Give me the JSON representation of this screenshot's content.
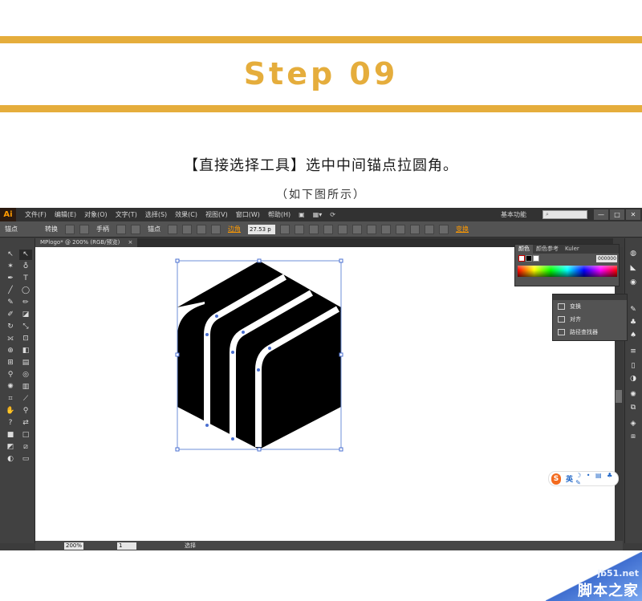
{
  "header": {
    "step": "Step 09",
    "instruction": "【直接选择工具】选中中间锚点拉圆角。",
    "subtitle": "（如下图所示）",
    "accent_color": "#e5ad3c"
  },
  "app": {
    "logo": "Ai",
    "menu": [
      "文件(F)",
      "编辑(E)",
      "对象(O)",
      "文字(T)",
      "选择(S)",
      "效果(C)",
      "视图(V)",
      "窗口(W)",
      "帮助(H)"
    ],
    "workspace": "基本功能",
    "window_buttons": [
      "—",
      "□",
      "✕"
    ]
  },
  "control_bar": {
    "anchor_label": "锚点",
    "convert_label": "转换",
    "handle_label": "手柄",
    "anchor_point_label": "锚点",
    "corner_label": "边角",
    "corner_value": "27.53 p",
    "transform_label": "变换"
  },
  "document": {
    "tab_title": "MPlogo* @ 200% (RGB/预览)",
    "tab_close": "×"
  },
  "status_bar": {
    "zoom": "200%",
    "page": "1",
    "tool": "选择"
  },
  "color_panel": {
    "tabs": [
      "颜色",
      "颜色参考",
      "Kuler"
    ],
    "hex": "000000"
  },
  "float_panel": {
    "items": [
      "变换",
      "对齐",
      "路径查找器"
    ]
  },
  "ime": {
    "logo": "S",
    "lang": "英",
    "tools": "☽ • ▤ ♣ ✎"
  },
  "watermark": {
    "url": "jb51.net",
    "name": "脚本之家"
  }
}
